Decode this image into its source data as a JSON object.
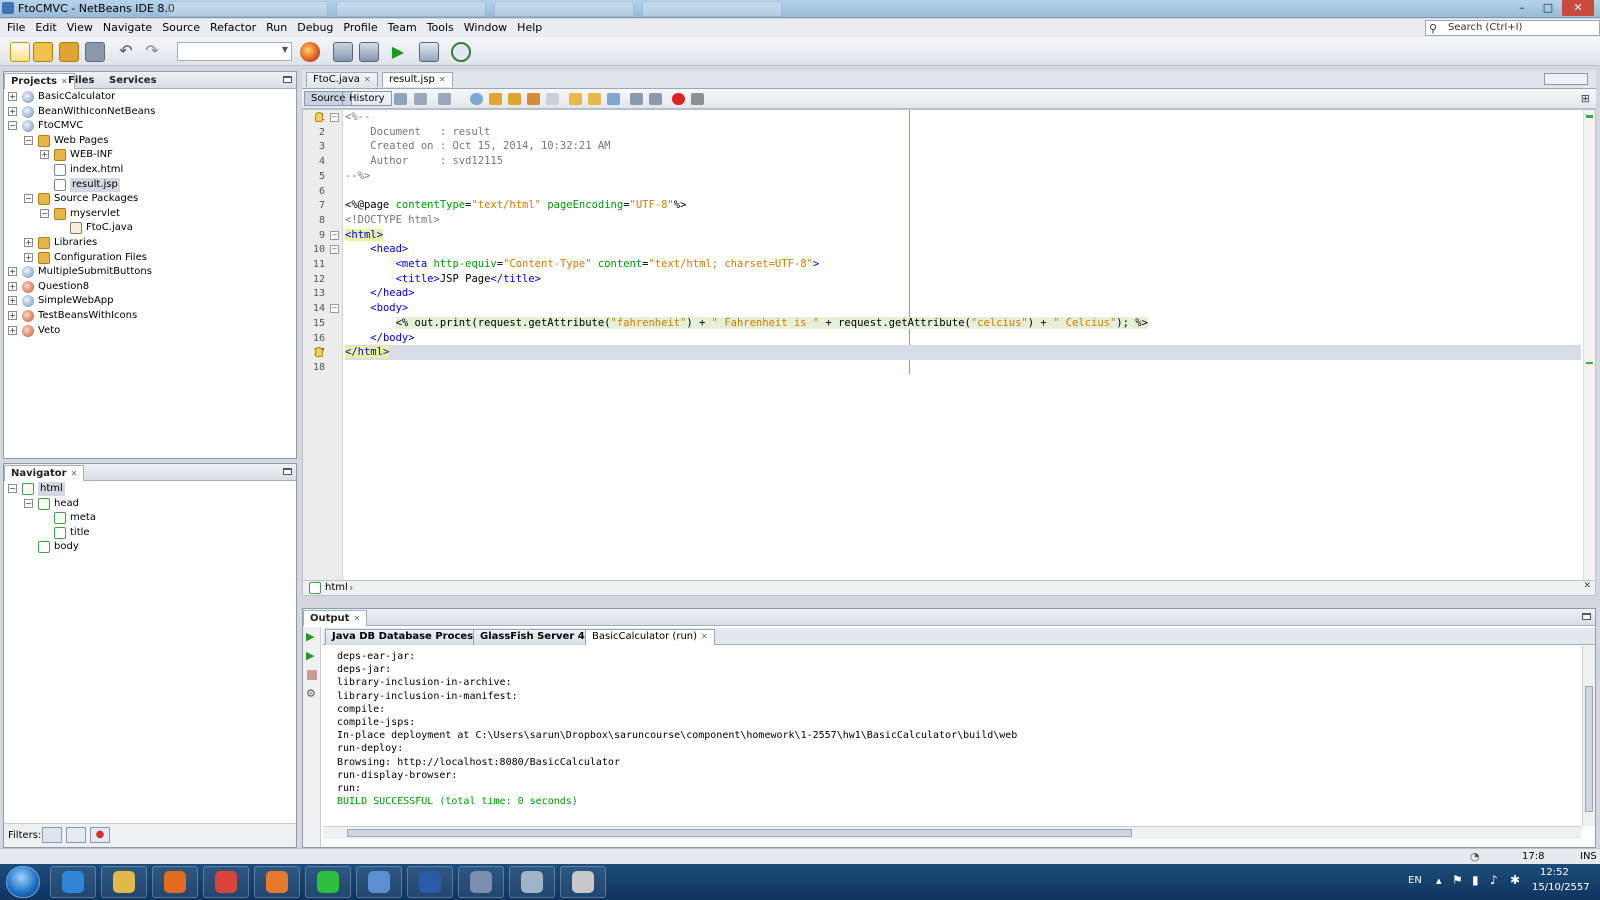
{
  "window": {
    "title": "FtoCMVC - NetBeans IDE 8.0",
    "buttons": {
      "minimize": "–",
      "maximize": "□",
      "close": "✕"
    }
  },
  "menu": [
    "File",
    "Edit",
    "View",
    "Navigate",
    "Source",
    "Refactor",
    "Run",
    "Debug",
    "Profile",
    "Team",
    "Tools",
    "Window",
    "Help"
  ],
  "search": {
    "placeholder": "Search (Ctrl+I)"
  },
  "projects_panel": {
    "tabs": [
      "Projects",
      "Files",
      "Services"
    ],
    "tree": [
      {
        "label": "BasicCalculator",
        "depth": 0,
        "icon": "project-icon",
        "expander": "+"
      },
      {
        "label": "BeanWithIconNetBeans",
        "depth": 0,
        "icon": "project-icon",
        "expander": "+"
      },
      {
        "label": "FtoCMVC",
        "depth": 0,
        "icon": "project-icon",
        "expander": "−"
      },
      {
        "label": "Web Pages",
        "depth": 1,
        "icon": "folder-icon",
        "expander": "−"
      },
      {
        "label": "WEB-INF",
        "depth": 2,
        "icon": "folder-icon",
        "expander": "+"
      },
      {
        "label": "index.html",
        "depth": 2,
        "icon": "file-icon",
        "expander": ""
      },
      {
        "label": "result.jsp",
        "depth": 2,
        "icon": "file-icon",
        "expander": "",
        "selected": true
      },
      {
        "label": "Source Packages",
        "depth": 1,
        "icon": "folder-icon",
        "expander": "−"
      },
      {
        "label": "myservlet",
        "depth": 2,
        "icon": "package-icon",
        "expander": "−"
      },
      {
        "label": "FtoC.java",
        "depth": 3,
        "icon": "java-file-icon",
        "expander": ""
      },
      {
        "label": "Libraries",
        "depth": 1,
        "icon": "folder-icon",
        "expander": "+"
      },
      {
        "label": "Configuration Files",
        "depth": 1,
        "icon": "folder-icon",
        "expander": "+"
      },
      {
        "label": "MultipleSubmitButtons",
        "depth": 0,
        "icon": "project-icon",
        "expander": "+"
      },
      {
        "label": "Question8",
        "depth": 0,
        "icon": "project-red-icon",
        "expander": "+"
      },
      {
        "label": "SimpleWebApp",
        "depth": 0,
        "icon": "project-icon",
        "expander": "+"
      },
      {
        "label": "TestBeansWithIcons",
        "depth": 0,
        "icon": "project-red-icon",
        "expander": "+"
      },
      {
        "label": "Veto",
        "depth": 0,
        "icon": "project-red-icon",
        "expander": "+"
      }
    ]
  },
  "navigator_panel": {
    "title": "Navigator",
    "tree": [
      {
        "label": "html",
        "depth": 0,
        "expander": "−",
        "selected": true
      },
      {
        "label": "head",
        "depth": 1,
        "expander": "−"
      },
      {
        "label": "meta",
        "depth": 2,
        "expander": ""
      },
      {
        "label": "title",
        "depth": 2,
        "expander": ""
      },
      {
        "label": "body",
        "depth": 1,
        "expander": ""
      }
    ],
    "filters_label": "Filters:"
  },
  "editor": {
    "tabs": [
      "FtoC.java",
      "result.jsp"
    ],
    "active_tab": "result.jsp",
    "view_toggles": [
      "Source",
      "History"
    ],
    "lines": [
      [
        {
          "t": "<%--",
          "c": "cm"
        }
      ],
      [
        {
          "t": "    Document   : result",
          "c": "cm"
        }
      ],
      [
        {
          "t": "    Created on : Oct 15, 2014, 10:32:21 AM",
          "c": "cm"
        }
      ],
      [
        {
          "t": "    Author     : svd12115",
          "c": "cm"
        }
      ],
      [
        {
          "t": "--%>",
          "c": "cm"
        }
      ],
      [
        {
          "t": "",
          "c": ""
        }
      ],
      [
        {
          "t": "<%@page ",
          "c": ""
        },
        {
          "t": "contentType",
          "c": "at"
        },
        {
          "t": "=",
          "c": ""
        },
        {
          "t": "\"text/html\"",
          "c": "sv"
        },
        {
          "t": " ",
          "c": ""
        },
        {
          "t": "pageEncoding",
          "c": "at"
        },
        {
          "t": "=",
          "c": ""
        },
        {
          "t": "\"UTF-8\"",
          "c": "sv"
        },
        {
          "t": "%>",
          "c": ""
        }
      ],
      [
        {
          "t": "<!DOCTYPE html>",
          "c": "cm"
        }
      ],
      [
        {
          "t": "<html>",
          "c": "tg hl"
        }
      ],
      [
        {
          "t": "    ",
          "c": ""
        },
        {
          "t": "<head>",
          "c": "tg"
        }
      ],
      [
        {
          "t": "        ",
          "c": ""
        },
        {
          "t": "<meta ",
          "c": "tg"
        },
        {
          "t": "http-equiv",
          "c": "at"
        },
        {
          "t": "=",
          "c": ""
        },
        {
          "t": "\"Content-Type\"",
          "c": "sv"
        },
        {
          "t": " ",
          "c": ""
        },
        {
          "t": "content",
          "c": "at"
        },
        {
          "t": "=",
          "c": ""
        },
        {
          "t": "\"text/html; charset=UTF-8\"",
          "c": "sv"
        },
        {
          "t": ">",
          "c": "tg"
        }
      ],
      [
        {
          "t": "        ",
          "c": ""
        },
        {
          "t": "<title>",
          "c": "tg"
        },
        {
          "t": "JSP Page",
          "c": ""
        },
        {
          "t": "</title>",
          "c": "tg"
        }
      ],
      [
        {
          "t": "    ",
          "c": ""
        },
        {
          "t": "</head>",
          "c": "tg"
        }
      ],
      [
        {
          "t": "    ",
          "c": ""
        },
        {
          "t": "<body>",
          "c": "tg"
        }
      ],
      [
        {
          "t": "        ",
          "c": ""
        },
        {
          "t": "<% out.print(request.getAttribute(",
          "c": "scr"
        },
        {
          "t": "\"fahrenheit\"",
          "c": "sv scr"
        },
        {
          "t": ") + ",
          "c": "scr"
        },
        {
          "t": "\" Fahrenheit is \"",
          "c": "sv scr"
        },
        {
          "t": " + request.getAttribute(",
          "c": "scr"
        },
        {
          "t": "\"celcius\"",
          "c": "sv scr"
        },
        {
          "t": ") + ",
          "c": "scr"
        },
        {
          "t": "\" Celcius\"",
          "c": "sv scr"
        },
        {
          "t": "); %>",
          "c": "scr"
        }
      ],
      [
        {
          "t": "    ",
          "c": ""
        },
        {
          "t": "</body>",
          "c": "tg"
        }
      ],
      [
        {
          "t": "</html>",
          "c": "tg hl"
        }
      ],
      [
        {
          "t": "",
          "c": ""
        }
      ]
    ],
    "breadcrumb": "html"
  },
  "output": {
    "title": "Output",
    "tabs": [
      "Java DB Database Process",
      "GlassFish Server 4",
      "BasicCalculator (run)"
    ],
    "active_tab": "BasicCalculator (run)",
    "lines": [
      {
        "t": "deps-ear-jar:",
        "c": ""
      },
      {
        "t": "deps-jar:",
        "c": ""
      },
      {
        "t": "library-inclusion-in-archive:",
        "c": ""
      },
      {
        "t": "library-inclusion-in-manifest:",
        "c": ""
      },
      {
        "t": "compile:",
        "c": ""
      },
      {
        "t": "compile-jsps:",
        "c": ""
      },
      {
        "t": "In-place deployment at C:\\Users\\sarun\\Dropbox\\saruncourse\\component\\homework\\1-2557\\hw1\\BasicCalculator\\build\\web",
        "c": ""
      },
      {
        "t": "run-deploy:",
        "c": ""
      },
      {
        "t": "Browsing: http://localhost:8080/BasicCalculator",
        "c": ""
      },
      {
        "t": "run-display-browser:",
        "c": ""
      },
      {
        "t": "run:",
        "c": ""
      },
      {
        "t": "BUILD SUCCESSFUL (total time: 0 seconds)",
        "c": "ok"
      }
    ]
  },
  "statusbar": {
    "position": "17:8",
    "mode": "INS"
  },
  "taskbar": {
    "language": "EN",
    "time": "12:52",
    "date": "15/10/2557",
    "apps": [
      "internet-explorer",
      "file-explorer",
      "media-player",
      "chrome",
      "firefox",
      "line",
      "tools",
      "word",
      "virtualbox",
      "notepad",
      "paint"
    ]
  }
}
